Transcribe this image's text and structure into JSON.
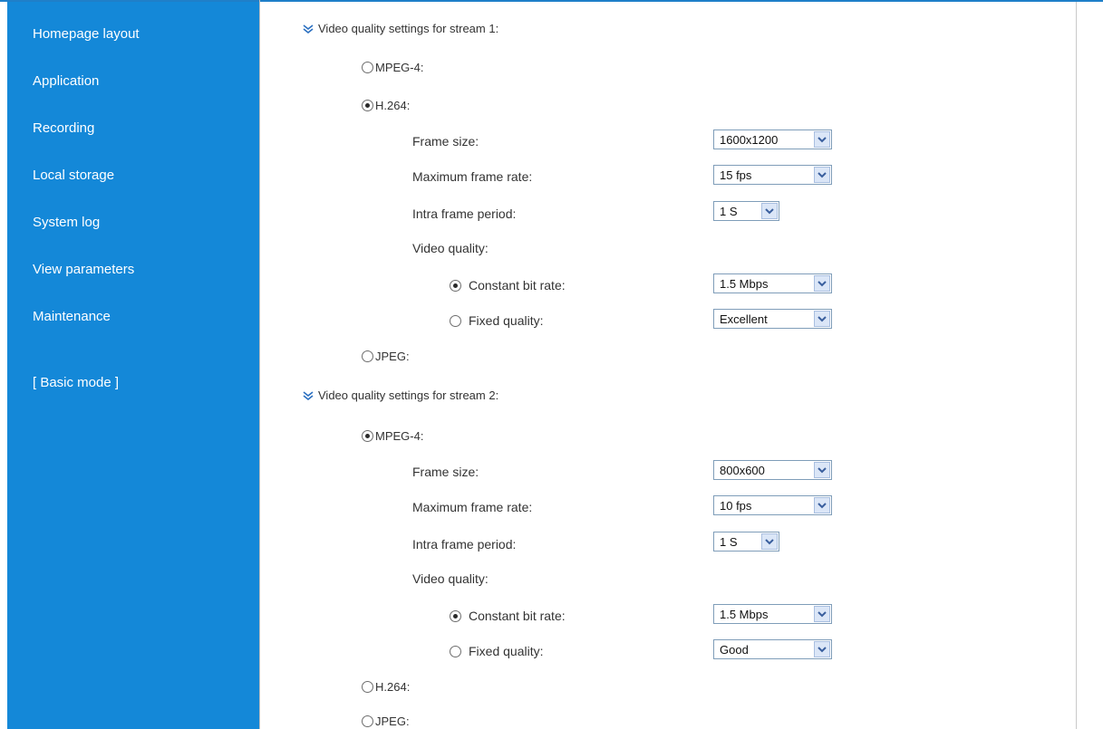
{
  "sidebar": {
    "items": [
      {
        "label": "Homepage layout"
      },
      {
        "label": "Application"
      },
      {
        "label": "Recording"
      },
      {
        "label": "Local storage"
      },
      {
        "label": "System log"
      },
      {
        "label": "View parameters"
      },
      {
        "label": "Maintenance"
      }
    ],
    "mode_link": "[ Basic mode ]"
  },
  "stream1": {
    "header": "Video quality settings for stream 1:",
    "codec_mpeg4": "MPEG-4:",
    "codec_h264": "H.264:",
    "codec_jpeg": "JPEG:",
    "selected_codec": "H.264",
    "frame_size_label": "Frame size:",
    "frame_size_value": "1600x1200",
    "max_frame_rate_label": "Maximum frame rate:",
    "max_frame_rate_value": "15 fps",
    "intra_period_label": "Intra frame period:",
    "intra_period_value": "1 S",
    "video_quality_label": "Video quality:",
    "cbr_label": "Constant bit rate:",
    "cbr_value": "1.5 Mbps",
    "fixed_label": "Fixed quality:",
    "fixed_value": "Excellent",
    "selected_quality": "Constant bit rate"
  },
  "stream2": {
    "header": "Video quality settings for stream 2:",
    "codec_mpeg4": "MPEG-4:",
    "codec_h264": "H.264:",
    "codec_jpeg": "JPEG:",
    "selected_codec": "MPEG-4",
    "frame_size_label": "Frame size:",
    "frame_size_value": "800x600",
    "max_frame_rate_label": "Maximum frame rate:",
    "max_frame_rate_value": "10 fps",
    "intra_period_label": "Intra frame period:",
    "intra_period_value": "1 S",
    "video_quality_label": "Video quality:",
    "cbr_label": "Constant bit rate:",
    "cbr_value": "1.5 Mbps",
    "fixed_label": "Fixed quality:",
    "fixed_value": "Good",
    "selected_quality": "Constant bit rate"
  },
  "colors": {
    "sidebar_bg": "#1488d8",
    "sidebar_text": "#ffffff"
  },
  "icons": {
    "section_expand": "double-chevron-down-icon",
    "select_dropdown": "chevron-down-icon"
  }
}
